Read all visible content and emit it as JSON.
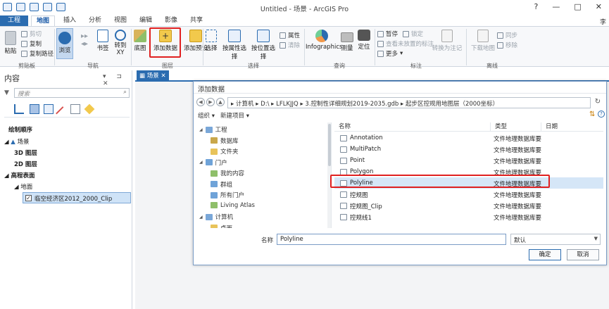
{
  "titlebar": {
    "title": "Untitled - 场景 - ArcGIS Pro",
    "controls": [
      "?",
      "—",
      "□",
      "✕"
    ]
  },
  "ribbon_tabs": [
    "工程",
    "地图",
    "插入",
    "分析",
    "视图",
    "编辑",
    "影像",
    "共享"
  ],
  "active_tab": "地图",
  "user_char": "李",
  "ribbon": {
    "clipboard": {
      "paste": "粘贴",
      "cut": "剪切",
      "copy": "复制",
      "copy_path": "复制路径",
      "label": "剪贴板"
    },
    "navigate": {
      "explore": "浏览",
      "bookmarks": "书签",
      "goto_xy": "转到\nXY",
      "label": "导航"
    },
    "layer": {
      "basemap": "底图",
      "add_data": "添加数据",
      "add_preset": "添加预设",
      "label": "图层"
    },
    "selection": {
      "select": "选择",
      "by_attr": "按属性选择",
      "by_loc": "按位置选择",
      "attributes": "属性",
      "clear": "清除",
      "label": "选择"
    },
    "inquiry": {
      "infographics": "Infographics",
      "measure": "测量",
      "locate": "定位",
      "label": "查询"
    },
    "labeling": {
      "pause": "暂停",
      "lock": "锁定",
      "view_unplaced": "查看未放置的标注",
      "more": "更多",
      "convert": "转换为注记",
      "label": "标注"
    },
    "offline": {
      "download": "下载地图",
      "sync": "同步",
      "remove": "移除",
      "label": "离线"
    }
  },
  "contents": {
    "title": "内容",
    "controls": "▾ ⊐ ✕",
    "search_placeholder": "搜索",
    "draw_order": "绘制顺序",
    "scene": "场景",
    "layer_3d": "3D 图层",
    "layer_2d": "2D 图层",
    "elevation": "高程表面",
    "ground": "地面",
    "layer_name": "临空经济区2012_2000_Clip"
  },
  "map_tab": {
    "label": "场景",
    "close": "✕"
  },
  "dialog": {
    "title": "添加数据",
    "path": [
      "计算机",
      "D:\\",
      "LFLKJJQ",
      "3.控制性详细规划2019-2035.gdb",
      "起步区控规用地图层（2000坐标）"
    ],
    "organize": "组织 ▾",
    "new_item": "新建项目 ▾",
    "nav_items": [
      {
        "label": "工程",
        "icon": "project-icon",
        "level": 0
      },
      {
        "label": "数据库",
        "icon": "database-icon",
        "level": 1
      },
      {
        "label": "文件夹",
        "icon": "folder-icon",
        "level": 1
      },
      {
        "label": "门户",
        "icon": "portal-icon",
        "level": 0
      },
      {
        "label": "我的内容",
        "icon": "my-content-icon",
        "level": 1
      },
      {
        "label": "群组",
        "icon": "groups-icon",
        "level": 1
      },
      {
        "label": "所有门户",
        "icon": "all-portal-icon",
        "level": 1
      },
      {
        "label": "Living Atlas",
        "icon": "atlas-icon",
        "level": 1
      },
      {
        "label": "计算机",
        "icon": "computer-icon",
        "level": 0
      },
      {
        "label": "桌面",
        "icon": "desktop-icon",
        "level": 1
      }
    ],
    "columns": {
      "name": "名称",
      "type": "类型",
      "date": "日期"
    },
    "files": [
      {
        "name": "Annotation",
        "type": "文件地理数据库要"
      },
      {
        "name": "MultiPatch",
        "type": "文件地理数据库要"
      },
      {
        "name": "Point",
        "type": "文件地理数据库要"
      },
      {
        "name": "Polygon",
        "type": "文件地理数据库要"
      },
      {
        "name": "Polyline",
        "type": "文件地理数据库要"
      },
      {
        "name": "控规图",
        "type": "文件地理数据库要"
      },
      {
        "name": "控规图_Clip",
        "type": "文件地理数据库要"
      },
      {
        "name": "控规线1",
        "type": "文件地理数据库要"
      }
    ],
    "selected_file": "Polyline",
    "name_label": "名称",
    "name_value": "Polyline",
    "filter": "默认",
    "ok": "确定",
    "cancel": "取消"
  },
  "colors": {
    "accent": "#2b6cb0",
    "highlight": "#e02020",
    "selection": "#d5e6f7"
  }
}
